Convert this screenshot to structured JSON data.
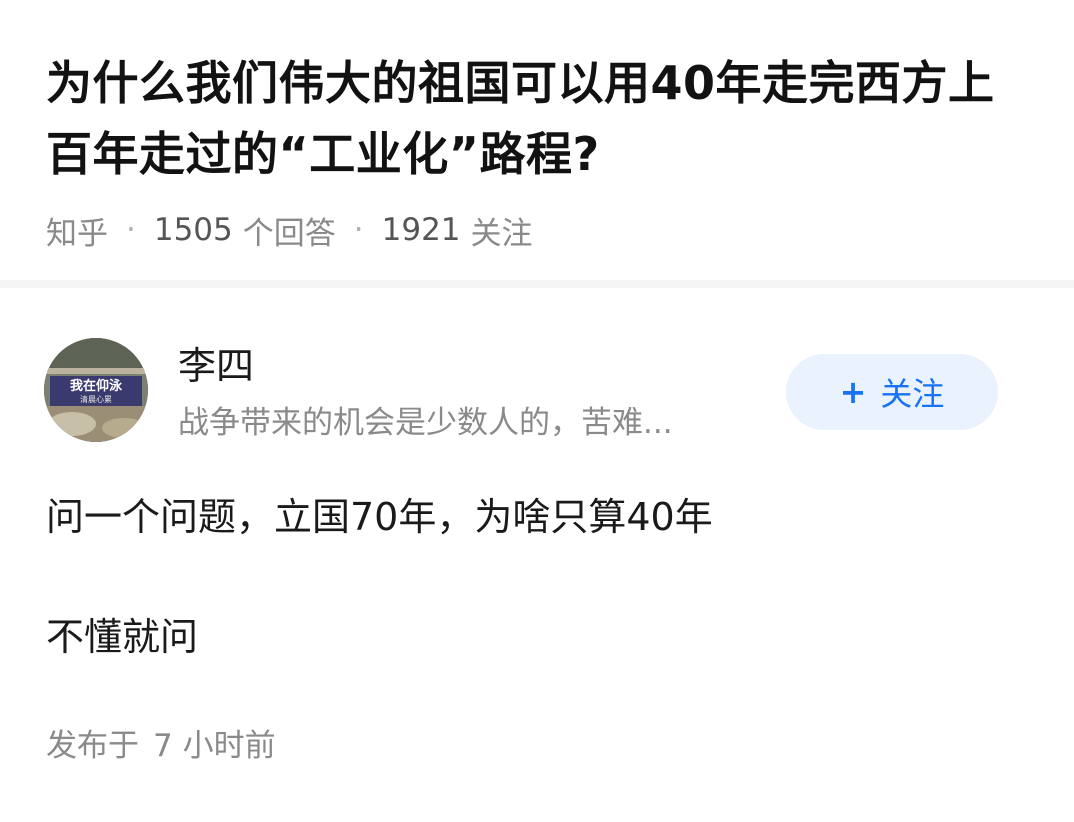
{
  "question": {
    "title": "为什么我们伟大的祖国可以用40年走完西方上百年走过的“工业化”路程?",
    "source": "知乎",
    "answer_count": "1505",
    "answer_label": "个回答",
    "follower_count": "1921",
    "follower_label": "关注"
  },
  "author": {
    "name": "李四",
    "bio": "战争带来的机会是少数人的，苦难...",
    "avatar_text_line1": "我在仰泳",
    "avatar_text_line2": "清晨心累",
    "follow_label": "关注",
    "follow_icon": "plus-icon"
  },
  "answer": {
    "paragraphs": [
      "问一个问题，立国70年，为啥只算40年",
      "不懂就问"
    ],
    "published_prefix": "发布于",
    "published_time": "7 小时前"
  },
  "colors": {
    "accent": "#1772f6",
    "follow_bg": "#eaf2fd",
    "muted_text": "#8a8a8a",
    "title_text": "#121212"
  }
}
